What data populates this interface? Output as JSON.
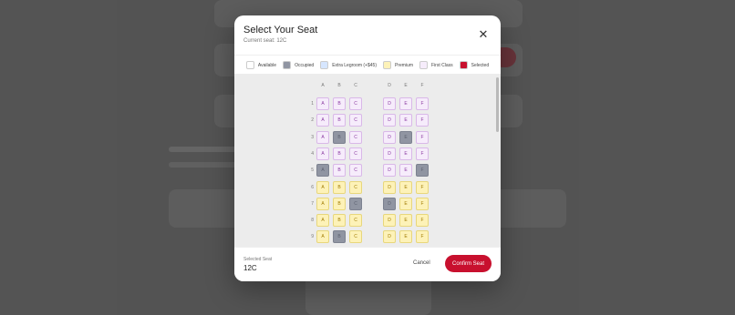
{
  "modal": {
    "title": "Select Your Seat",
    "current_seat": "Current seat: 12C",
    "close_icon": "close-icon"
  },
  "legend": [
    {
      "label": "Available",
      "color": "#ffffff"
    },
    {
      "label": "Occupied",
      "color": "#9095a2"
    },
    {
      "label": "Extra Legroom (+$45)",
      "color": "#d6e6ff"
    },
    {
      "label": "Premium",
      "color": "#fdf2b8"
    },
    {
      "label": "First Class",
      "color": "#f6ecfb"
    },
    {
      "label": "Selected",
      "color": "#c8102e"
    }
  ],
  "columns": [
    "A",
    "B",
    "C",
    "D",
    "E",
    "F"
  ],
  "rows": [
    {
      "num": "1",
      "seats": [
        {
          "l": "A",
          "s": "first"
        },
        {
          "l": "B",
          "s": "first"
        },
        {
          "l": "C",
          "s": "first"
        },
        {
          "l": "D",
          "s": "first"
        },
        {
          "l": "E",
          "s": "first"
        },
        {
          "l": "F",
          "s": "first"
        }
      ]
    },
    {
      "num": "2",
      "seats": [
        {
          "l": "A",
          "s": "first"
        },
        {
          "l": "B",
          "s": "first"
        },
        {
          "l": "C",
          "s": "first"
        },
        {
          "l": "D",
          "s": "first"
        },
        {
          "l": "E",
          "s": "first"
        },
        {
          "l": "F",
          "s": "first"
        }
      ]
    },
    {
      "num": "3",
      "seats": [
        {
          "l": "A",
          "s": "first"
        },
        {
          "l": "B",
          "s": "occ"
        },
        {
          "l": "C",
          "s": "first"
        },
        {
          "l": "D",
          "s": "first"
        },
        {
          "l": "E",
          "s": "occ"
        },
        {
          "l": "F",
          "s": "first"
        }
      ]
    },
    {
      "num": "4",
      "seats": [
        {
          "l": "A",
          "s": "first"
        },
        {
          "l": "B",
          "s": "first"
        },
        {
          "l": "C",
          "s": "first"
        },
        {
          "l": "D",
          "s": "first"
        },
        {
          "l": "E",
          "s": "first"
        },
        {
          "l": "F",
          "s": "first"
        }
      ]
    },
    {
      "num": "5",
      "seats": [
        {
          "l": "A",
          "s": "occ"
        },
        {
          "l": "B",
          "s": "first"
        },
        {
          "l": "C",
          "s": "first"
        },
        {
          "l": "D",
          "s": "first"
        },
        {
          "l": "E",
          "s": "first"
        },
        {
          "l": "F",
          "s": "occ"
        }
      ]
    },
    {
      "num": "6",
      "seats": [
        {
          "l": "A",
          "s": "prem"
        },
        {
          "l": "B",
          "s": "prem"
        },
        {
          "l": "C",
          "s": "prem"
        },
        {
          "l": "D",
          "s": "prem"
        },
        {
          "l": "E",
          "s": "prem"
        },
        {
          "l": "F",
          "s": "prem"
        }
      ]
    },
    {
      "num": "7",
      "seats": [
        {
          "l": "A",
          "s": "prem"
        },
        {
          "l": "B",
          "s": "prem"
        },
        {
          "l": "C",
          "s": "occ"
        },
        {
          "l": "D",
          "s": "occ"
        },
        {
          "l": "E",
          "s": "prem"
        },
        {
          "l": "F",
          "s": "prem"
        }
      ]
    },
    {
      "num": "8",
      "seats": [
        {
          "l": "A",
          "s": "prem"
        },
        {
          "l": "B",
          "s": "prem"
        },
        {
          "l": "C",
          "s": "prem"
        },
        {
          "l": "D",
          "s": "prem"
        },
        {
          "l": "E",
          "s": "prem"
        },
        {
          "l": "F",
          "s": "prem"
        }
      ]
    },
    {
      "num": "9",
      "seats": [
        {
          "l": "A",
          "s": "prem"
        },
        {
          "l": "B",
          "s": "occ"
        },
        {
          "l": "C",
          "s": "prem"
        },
        {
          "l": "D",
          "s": "prem"
        },
        {
          "l": "E",
          "s": "prem"
        },
        {
          "l": "F",
          "s": "prem"
        }
      ]
    }
  ],
  "footer": {
    "selected_label": "Selected Seat",
    "selected_value": "12C",
    "cancel_label": "Cancel",
    "confirm_label": "Confirm Seat",
    "accent": "#c8102e"
  }
}
